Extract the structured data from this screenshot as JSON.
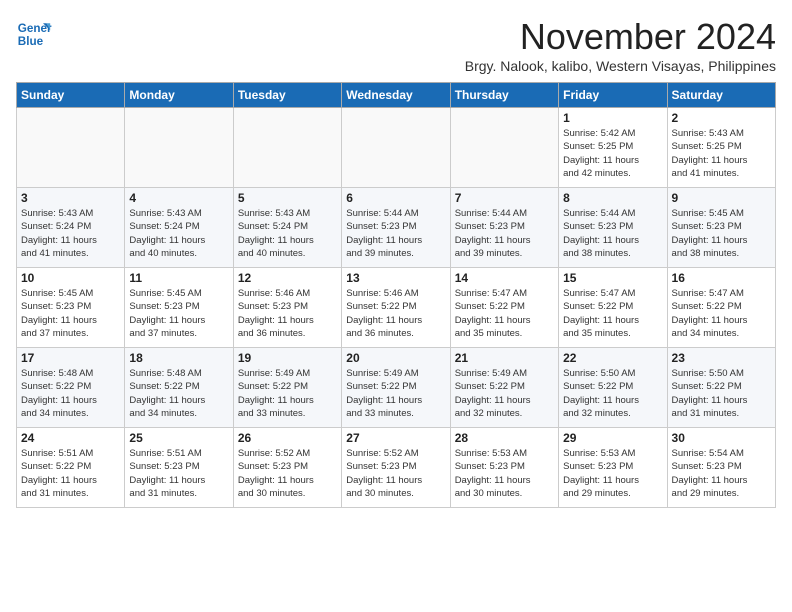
{
  "header": {
    "logo_line1": "General",
    "logo_line2": "Blue",
    "month": "November 2024",
    "location": "Brgy. Nalook, kalibo, Western Visayas, Philippines"
  },
  "weekdays": [
    "Sunday",
    "Monday",
    "Tuesday",
    "Wednesday",
    "Thursday",
    "Friday",
    "Saturday"
  ],
  "weeks": [
    [
      {
        "day": "",
        "info": ""
      },
      {
        "day": "",
        "info": ""
      },
      {
        "day": "",
        "info": ""
      },
      {
        "day": "",
        "info": ""
      },
      {
        "day": "",
        "info": ""
      },
      {
        "day": "1",
        "info": "Sunrise: 5:42 AM\nSunset: 5:25 PM\nDaylight: 11 hours\nand 42 minutes."
      },
      {
        "day": "2",
        "info": "Sunrise: 5:43 AM\nSunset: 5:25 PM\nDaylight: 11 hours\nand 41 minutes."
      }
    ],
    [
      {
        "day": "3",
        "info": "Sunrise: 5:43 AM\nSunset: 5:24 PM\nDaylight: 11 hours\nand 41 minutes."
      },
      {
        "day": "4",
        "info": "Sunrise: 5:43 AM\nSunset: 5:24 PM\nDaylight: 11 hours\nand 40 minutes."
      },
      {
        "day": "5",
        "info": "Sunrise: 5:43 AM\nSunset: 5:24 PM\nDaylight: 11 hours\nand 40 minutes."
      },
      {
        "day": "6",
        "info": "Sunrise: 5:44 AM\nSunset: 5:23 PM\nDaylight: 11 hours\nand 39 minutes."
      },
      {
        "day": "7",
        "info": "Sunrise: 5:44 AM\nSunset: 5:23 PM\nDaylight: 11 hours\nand 39 minutes."
      },
      {
        "day": "8",
        "info": "Sunrise: 5:44 AM\nSunset: 5:23 PM\nDaylight: 11 hours\nand 38 minutes."
      },
      {
        "day": "9",
        "info": "Sunrise: 5:45 AM\nSunset: 5:23 PM\nDaylight: 11 hours\nand 38 minutes."
      }
    ],
    [
      {
        "day": "10",
        "info": "Sunrise: 5:45 AM\nSunset: 5:23 PM\nDaylight: 11 hours\nand 37 minutes."
      },
      {
        "day": "11",
        "info": "Sunrise: 5:45 AM\nSunset: 5:23 PM\nDaylight: 11 hours\nand 37 minutes."
      },
      {
        "day": "12",
        "info": "Sunrise: 5:46 AM\nSunset: 5:23 PM\nDaylight: 11 hours\nand 36 minutes."
      },
      {
        "day": "13",
        "info": "Sunrise: 5:46 AM\nSunset: 5:22 PM\nDaylight: 11 hours\nand 36 minutes."
      },
      {
        "day": "14",
        "info": "Sunrise: 5:47 AM\nSunset: 5:22 PM\nDaylight: 11 hours\nand 35 minutes."
      },
      {
        "day": "15",
        "info": "Sunrise: 5:47 AM\nSunset: 5:22 PM\nDaylight: 11 hours\nand 35 minutes."
      },
      {
        "day": "16",
        "info": "Sunrise: 5:47 AM\nSunset: 5:22 PM\nDaylight: 11 hours\nand 34 minutes."
      }
    ],
    [
      {
        "day": "17",
        "info": "Sunrise: 5:48 AM\nSunset: 5:22 PM\nDaylight: 11 hours\nand 34 minutes."
      },
      {
        "day": "18",
        "info": "Sunrise: 5:48 AM\nSunset: 5:22 PM\nDaylight: 11 hours\nand 34 minutes."
      },
      {
        "day": "19",
        "info": "Sunrise: 5:49 AM\nSunset: 5:22 PM\nDaylight: 11 hours\nand 33 minutes."
      },
      {
        "day": "20",
        "info": "Sunrise: 5:49 AM\nSunset: 5:22 PM\nDaylight: 11 hours\nand 33 minutes."
      },
      {
        "day": "21",
        "info": "Sunrise: 5:49 AM\nSunset: 5:22 PM\nDaylight: 11 hours\nand 32 minutes."
      },
      {
        "day": "22",
        "info": "Sunrise: 5:50 AM\nSunset: 5:22 PM\nDaylight: 11 hours\nand 32 minutes."
      },
      {
        "day": "23",
        "info": "Sunrise: 5:50 AM\nSunset: 5:22 PM\nDaylight: 11 hours\nand 31 minutes."
      }
    ],
    [
      {
        "day": "24",
        "info": "Sunrise: 5:51 AM\nSunset: 5:22 PM\nDaylight: 11 hours\nand 31 minutes."
      },
      {
        "day": "25",
        "info": "Sunrise: 5:51 AM\nSunset: 5:23 PM\nDaylight: 11 hours\nand 31 minutes."
      },
      {
        "day": "26",
        "info": "Sunrise: 5:52 AM\nSunset: 5:23 PM\nDaylight: 11 hours\nand 30 minutes."
      },
      {
        "day": "27",
        "info": "Sunrise: 5:52 AM\nSunset: 5:23 PM\nDaylight: 11 hours\nand 30 minutes."
      },
      {
        "day": "28",
        "info": "Sunrise: 5:53 AM\nSunset: 5:23 PM\nDaylight: 11 hours\nand 30 minutes."
      },
      {
        "day": "29",
        "info": "Sunrise: 5:53 AM\nSunset: 5:23 PM\nDaylight: 11 hours\nand 29 minutes."
      },
      {
        "day": "30",
        "info": "Sunrise: 5:54 AM\nSunset: 5:23 PM\nDaylight: 11 hours\nand 29 minutes."
      }
    ]
  ]
}
